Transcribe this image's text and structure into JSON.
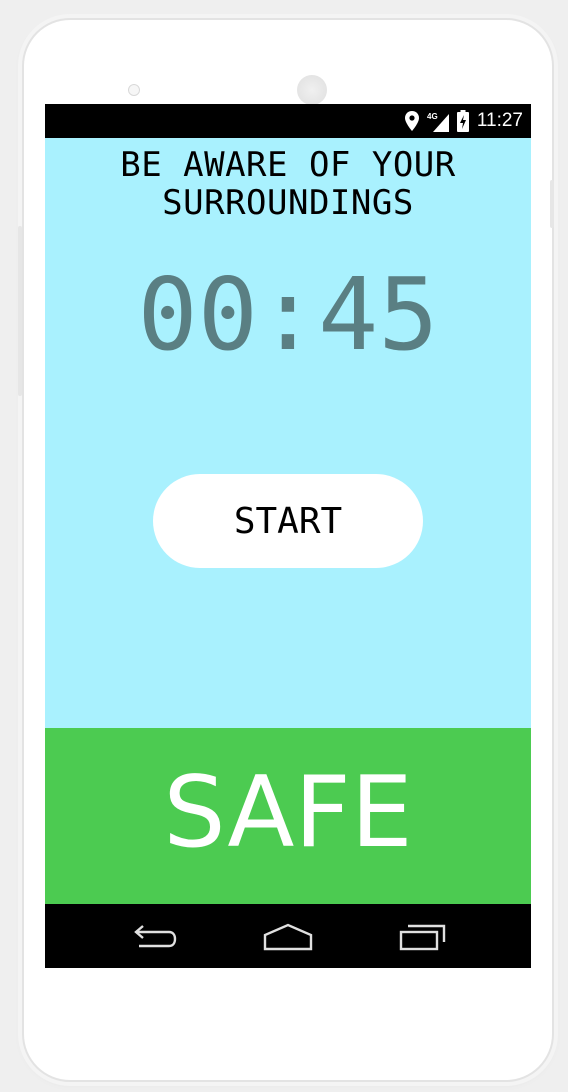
{
  "status_bar": {
    "time": "11:27",
    "icons": [
      "location-icon",
      "4g-signal-icon",
      "battery-charging-icon"
    ],
    "network_label": "4G"
  },
  "main": {
    "heading_line1": "BE AWARE OF YOUR",
    "heading_line2": "SURROUNDINGS",
    "timer": "00:45",
    "start_label": "START"
  },
  "safe_panel": {
    "label": "SAFE"
  },
  "nav_bar": {
    "buttons": [
      "back-icon",
      "home-icon",
      "recents-icon"
    ]
  },
  "colors": {
    "content_background": "#a9f1fe",
    "timer_text": "#5a7f83",
    "safe_background": "#4ccb51",
    "safe_text": "#ffffff"
  }
}
